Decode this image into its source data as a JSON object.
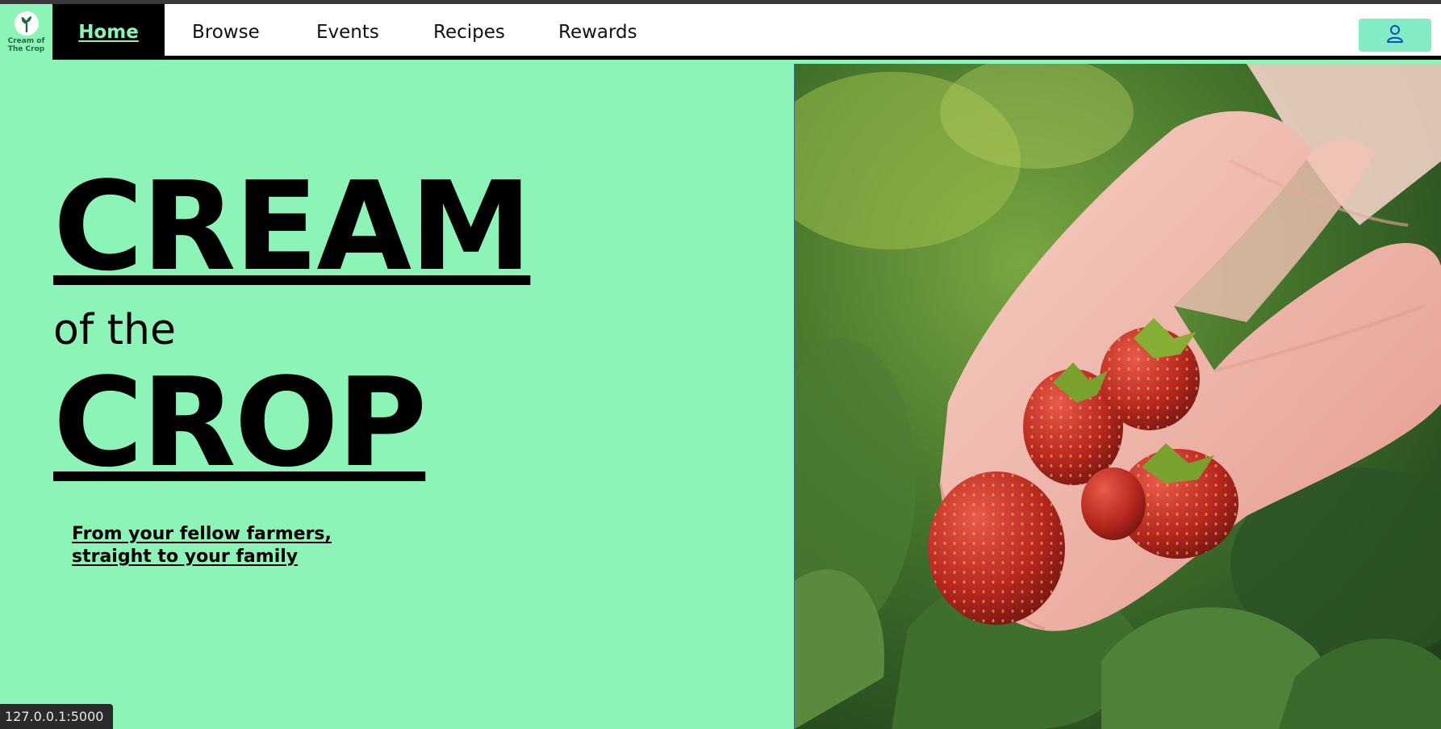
{
  "brand": {
    "logo_text_line1": "Cream of",
    "logo_text_line2": "The Crop",
    "logo_icon": "sprout-icon"
  },
  "nav": {
    "items": [
      {
        "label": "Home",
        "active": true
      },
      {
        "label": "Browse"
      },
      {
        "label": "Events"
      },
      {
        "label": "Recipes"
      },
      {
        "label": "Rewards"
      }
    ],
    "account_icon": "user-icon"
  },
  "hero": {
    "title_top": "CREAM",
    "title_middle": "of the",
    "title_bottom": "CROP",
    "tagline": "From your fellow farmers, straight to your family",
    "image_icon": "strawberries-in-hands-photo"
  },
  "status_bar": {
    "url": "127.0.0.1:5000"
  },
  "colors": {
    "mint": "#8df4b8",
    "nav_active_bg": "#000000",
    "account_button": "#83ecc4",
    "text": "#000000"
  }
}
